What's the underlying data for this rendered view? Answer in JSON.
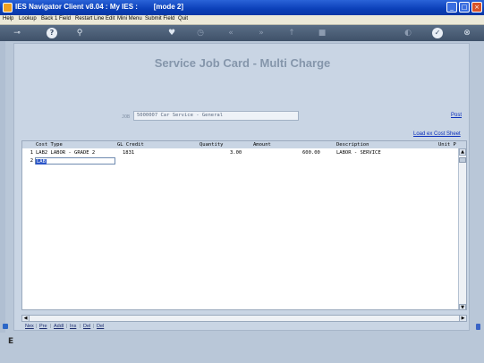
{
  "window": {
    "title": "IES Navigator Client v8.04 : My IES :        [mode 2]",
    "buttons": [
      "minimize-icon",
      "maximize-icon",
      "close-icon"
    ]
  },
  "menu": {
    "items": [
      "Help",
      "Lookup",
      "Back 1 Field",
      "Restart Line Edit",
      "Mini Menu",
      "Submit Field",
      "Quit"
    ]
  },
  "toolbar": {
    "icons": [
      "key-icon",
      "help-icon",
      "search-icon",
      "heart-icon",
      "history-icon",
      "back-icon",
      "forward-icon",
      "up-icon",
      "list-icon",
      "globe-icon",
      "confirm-icon",
      "cancel-icon"
    ]
  },
  "form": {
    "title": "Service Job Card - Multi Charge",
    "job_prefix": "JOB",
    "job_value": "5000007 Car Service - General",
    "post_link": "Post",
    "load_cost_sheet_link": "Load ex Cost Sheet"
  },
  "grid": {
    "columns": [
      "Cost Type",
      "GL Credit",
      "Quantity",
      "Amount",
      "Description",
      "Unit P"
    ],
    "rows": [
      {
        "num": "1",
        "cost_type": "LAB2 LABOR - GRADE 2",
        "gl_credit": "1831",
        "quantity": "3.00",
        "amount": "600.00",
        "description": "LABOR - SERVICE",
        "unit_price": ""
      },
      {
        "num": "2",
        "edit_value": "LAB",
        "cost_type": "",
        "gl_credit": "",
        "quantity": "",
        "amount": "",
        "description": "",
        "unit_price": ""
      }
    ]
  },
  "bottom_links": [
    "Nex",
    "Pre",
    "AddI",
    "Ins",
    "Del",
    "Del"
  ]
}
